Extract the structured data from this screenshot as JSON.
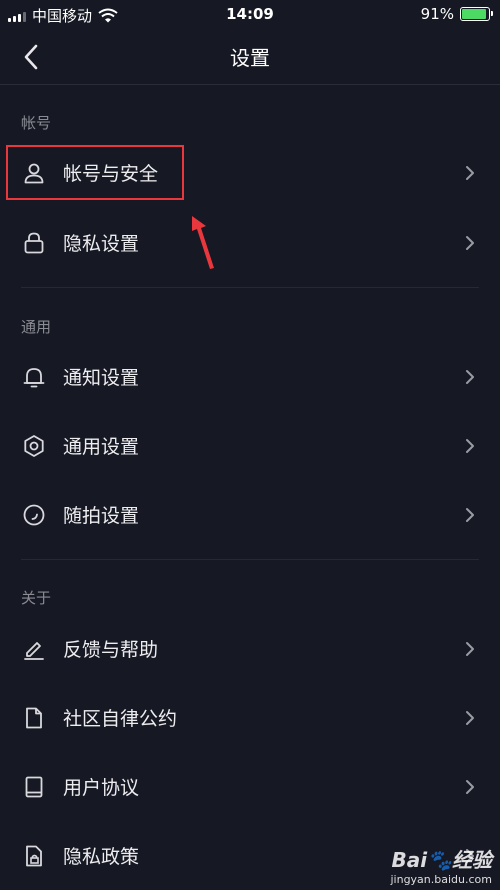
{
  "status": {
    "carrier": "中国移动",
    "time": "14:09",
    "battery": "91%",
    "battery_level": 0.91,
    "battery_color": "#4cd964"
  },
  "header": {
    "title": "设置",
    "back_icon": "chevron-left-icon"
  },
  "sections": [
    {
      "label": "帐号",
      "items": [
        {
          "label": "帐号与安全",
          "icon": "user-icon"
        },
        {
          "label": "隐私设置",
          "icon": "lock-icon"
        }
      ]
    },
    {
      "label": "通用",
      "items": [
        {
          "label": "通知设置",
          "icon": "bell-icon"
        },
        {
          "label": "通用设置",
          "icon": "gear-icon"
        },
        {
          "label": "随拍设置",
          "icon": "camera-circle-icon"
        }
      ]
    },
    {
      "label": "关于",
      "items": [
        {
          "label": "反馈与帮助",
          "icon": "edit-icon"
        },
        {
          "label": "社区自律公约",
          "icon": "document-icon"
        },
        {
          "label": "用户协议",
          "icon": "book-icon"
        },
        {
          "label": "隐私政策",
          "icon": "privacy-lock-icon"
        }
      ]
    }
  ],
  "annotation": {
    "color": "#e8383d"
  },
  "watermark": {
    "brand": "Bai🐾经验",
    "url": "jingyan.baidu.com"
  }
}
